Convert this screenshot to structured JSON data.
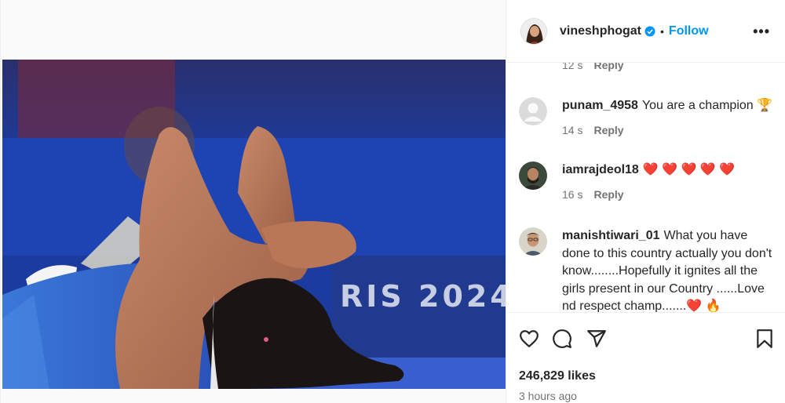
{
  "post": {
    "username": "vineshphogat",
    "follow_label": "Follow",
    "separator": "•",
    "more_label": "•••",
    "likes": "246,829 likes",
    "time_ago": "3 hours ago",
    "photo_text": "RIS 2024"
  },
  "partial_comment": {
    "time": "12 s",
    "reply": "Reply"
  },
  "comments": [
    {
      "user": "punam_4958",
      "text": "You are a champion 🏆",
      "time": "14 s",
      "reply": "Reply"
    },
    {
      "user": "iamrajdeol18",
      "text": "❤️ ❤️ ❤️ ❤️ ❤️",
      "time": "16 s",
      "reply": "Reply"
    },
    {
      "user": "manishtiwari_01",
      "text": "What you have done to this country actually you don't know........Hopefully it ignites all the girls present in our Country ......Love nd respect champ.......❤️ 🔥",
      "time": "",
      "reply": ""
    }
  ],
  "icons": {
    "like": "heart-icon",
    "comment": "comment-icon",
    "share": "share-icon",
    "save": "bookmark-icon",
    "verified": "verified-badge-icon",
    "more": "more-options-icon"
  },
  "colors": {
    "link": "#0095f6",
    "verified": "#0095f6",
    "muted": "#737373"
  }
}
